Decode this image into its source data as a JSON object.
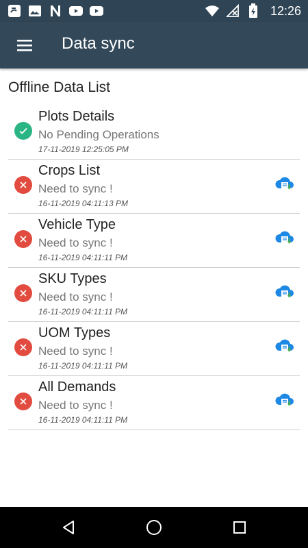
{
  "status_bar": {
    "time": "12:26",
    "left_icons": [
      "app-icon",
      "image-icon",
      "n-icon",
      "youtube-icon",
      "youtube-icon"
    ],
    "right_icons": [
      "wifi-icon",
      "no-signal-icon",
      "battery-icon"
    ]
  },
  "app_bar": {
    "title": "Data sync",
    "menu_icon": "hamburger-menu-icon"
  },
  "main": {
    "section_title": "Offline Data List",
    "items": [
      {
        "title": "Plots Details",
        "status": "No Pending Operations",
        "timestamp": "17-11-2019 12:25:05 PM",
        "state": "ok",
        "sync_button": false
      },
      {
        "title": "Crops List",
        "status": "Need to sync !",
        "timestamp": "16-11-2019 04:11:13 PM",
        "state": "error",
        "sync_button": true
      },
      {
        "title": "Vehicle Type",
        "status": "Need to sync !",
        "timestamp": "16-11-2019 04:11:11 PM",
        "state": "error",
        "sync_button": true
      },
      {
        "title": "SKU Types",
        "status": "Need to sync !",
        "timestamp": "16-11-2019 04:11:11 PM",
        "state": "error",
        "sync_button": true
      },
      {
        "title": "UOM Types",
        "status": "Need to sync !",
        "timestamp": "16-11-2019 04:11:11 PM",
        "state": "error",
        "sync_button": true
      },
      {
        "title": "All Demands",
        "status": "Need to sync !",
        "timestamp": "16-11-2019 04:11:11 PM",
        "state": "error",
        "sync_button": true
      }
    ]
  },
  "colors": {
    "status_bar": "#2f4454",
    "app_bar": "#33495a",
    "ok": "#2bb585",
    "error": "#e24b3f",
    "sync_cloud": "#1e88e5",
    "sync_arrow": "#4caf50"
  },
  "nav_bar": {
    "buttons": [
      "back-icon",
      "home-icon",
      "recents-icon"
    ]
  }
}
